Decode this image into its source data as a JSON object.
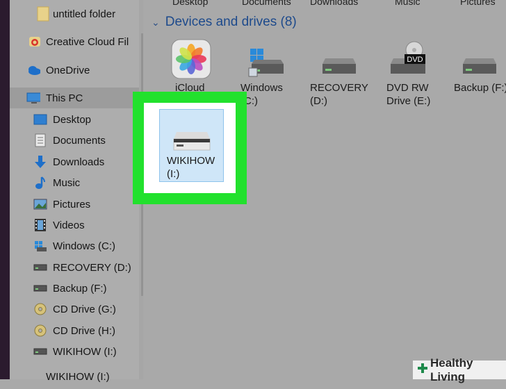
{
  "sidebar": {
    "items": [
      {
        "label": "untitled folder",
        "icon": "folder-icon"
      },
      {
        "label": "Creative Cloud Fil",
        "icon": "creative-cloud-icon"
      },
      {
        "label": "OneDrive",
        "icon": "onedrive-icon"
      },
      {
        "label": "This PC",
        "icon": "computer-icon"
      },
      {
        "label": "Desktop",
        "icon": "desktop-icon"
      },
      {
        "label": "Documents",
        "icon": "documents-icon"
      },
      {
        "label": "Downloads",
        "icon": "downloads-icon"
      },
      {
        "label": "Music",
        "icon": "music-icon"
      },
      {
        "label": "Pictures",
        "icon": "pictures-icon"
      },
      {
        "label": "Videos",
        "icon": "videos-icon"
      },
      {
        "label": "Windows (C:)",
        "icon": "windows-drive-icon"
      },
      {
        "label": "RECOVERY (D:)",
        "icon": "drive-icon"
      },
      {
        "label": "Backup (F:)",
        "icon": "drive-icon"
      },
      {
        "label": "CD Drive (G:)",
        "icon": "cd-icon"
      },
      {
        "label": "CD Drive (H:)",
        "icon": "cd-icon"
      },
      {
        "label": "WIKIHOW (I:)",
        "icon": "drive-icon"
      },
      {
        "label": "WIKIHOW (I:)",
        "icon": "drive-icon"
      }
    ]
  },
  "main": {
    "top_cut_labels": [
      "Desktop",
      "Documents",
      "Downloads",
      "Music",
      "Pictures"
    ],
    "section_title": "Devices and drives (8)",
    "drives": [
      {
        "label": "iCloud Photos",
        "icon": "icloud-photos-icon"
      },
      {
        "label": "Windows (C:)",
        "icon": "windows-drive-icon"
      },
      {
        "label": "RECOVERY (D:)",
        "icon": "drive-icon"
      },
      {
        "label": "DVD RW Drive (E:)",
        "icon": "dvd-drive-icon",
        "badge": "DVD"
      },
      {
        "label": "Backup (F:)",
        "icon": "drive-icon"
      }
    ],
    "selected_drive": {
      "label": "WIKIHOW (I:)",
      "icon": "drive-icon"
    }
  },
  "watermark": {
    "text": "Healthy Living"
  },
  "colors": {
    "highlight": "#22e12d",
    "selection": "#cfe6f8",
    "section_title": "#1d4a8c"
  }
}
